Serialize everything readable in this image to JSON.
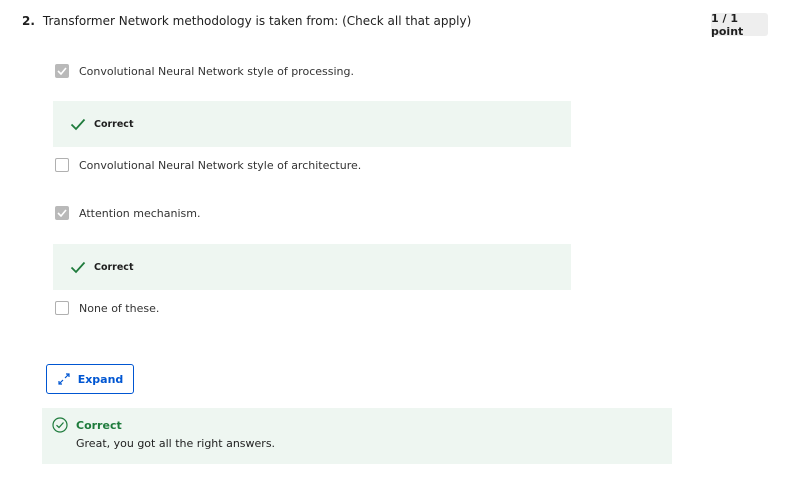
{
  "question": {
    "number": "2.",
    "text": "Transformer Network methodology is taken from: (Check all that apply)",
    "score": "1 / 1 point"
  },
  "options": [
    {
      "label": "Convolutional Neural Network style of processing.",
      "checked": true,
      "feedback": "Correct"
    },
    {
      "label": "Convolutional Neural Network style of architecture.",
      "checked": false
    },
    {
      "label": "Attention mechanism.",
      "checked": true,
      "feedback": "Correct"
    },
    {
      "label": "None of these.",
      "checked": false
    }
  ],
  "expand_button": {
    "label": "Expand",
    "icon": "expand-arrows-icon"
  },
  "result": {
    "title": "Correct",
    "message": "Great, you got all the right answers.",
    "icon": "check-circle-icon"
  },
  "colors": {
    "accent": "#0056d2",
    "success": "#1e7b3c",
    "feedback_bg": "#eef6f1",
    "checkbox_checked": "#b9b9b9",
    "badge_bg": "#eeeeee"
  }
}
